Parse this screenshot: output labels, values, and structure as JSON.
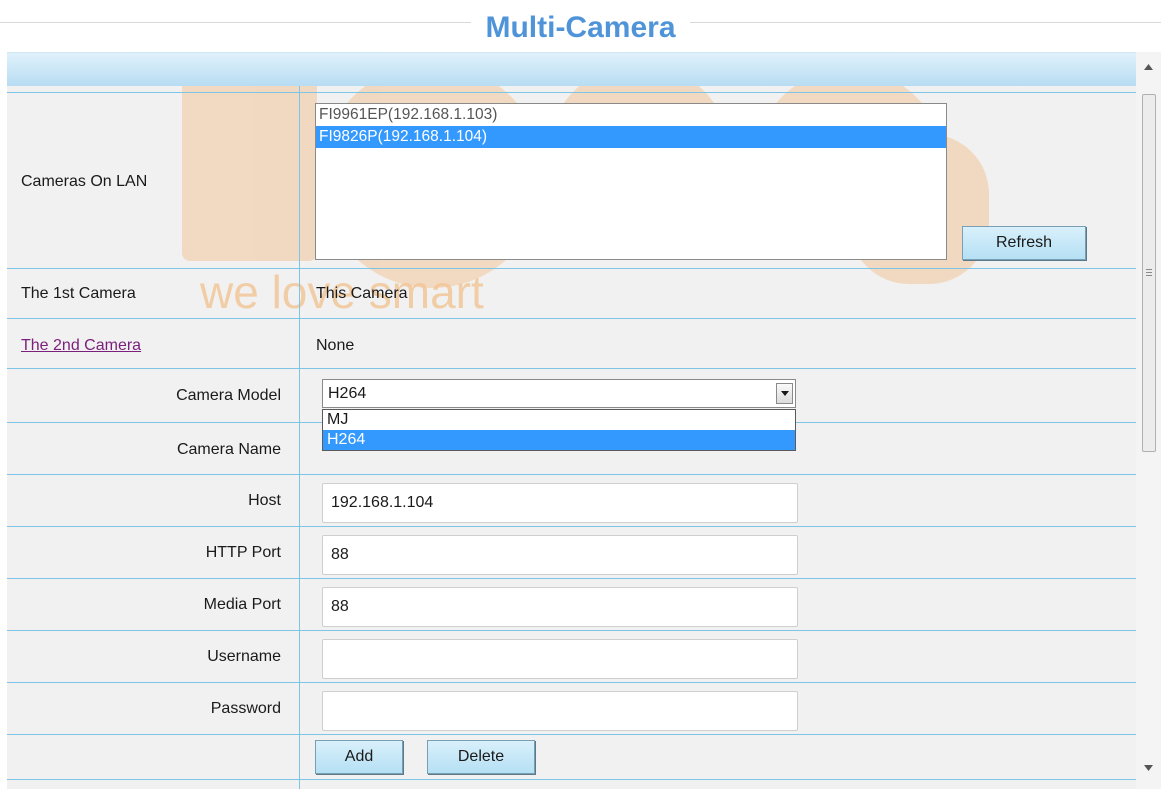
{
  "page": {
    "title": "Multi-Camera"
  },
  "watermark": {
    "text": "we love smart"
  },
  "lan": {
    "label": "Cameras On LAN",
    "items": [
      {
        "text": "FI9961EP(192.168.1.103)",
        "selected": false
      },
      {
        "text": "FI9826P(192.168.1.104)",
        "selected": true
      }
    ],
    "refresh_label": "Refresh"
  },
  "first_camera": {
    "label": "The 1st Camera",
    "value": "This Camera"
  },
  "second_camera": {
    "label": "The 2nd Camera",
    "value": "None"
  },
  "form": {
    "model_label": "Camera Model",
    "model_value": "H264",
    "model_options": [
      "MJ",
      "H264"
    ],
    "name_label": "Camera Name",
    "host_label": "Host",
    "host_value": "192.168.1.104",
    "http_port_label": "HTTP Port",
    "http_port_value": "88",
    "media_port_label": "Media Port",
    "media_port_value": "88",
    "username_label": "Username",
    "username_value": "",
    "password_label": "Password",
    "password_value": ""
  },
  "actions": {
    "add_label": "Add",
    "delete_label": "Delete"
  },
  "colors": {
    "title": "#4f94d9",
    "selection": "#3399ff",
    "grid": "#7ec4e6",
    "link": "#7a1f7a",
    "watermark": "#f2c79a"
  }
}
